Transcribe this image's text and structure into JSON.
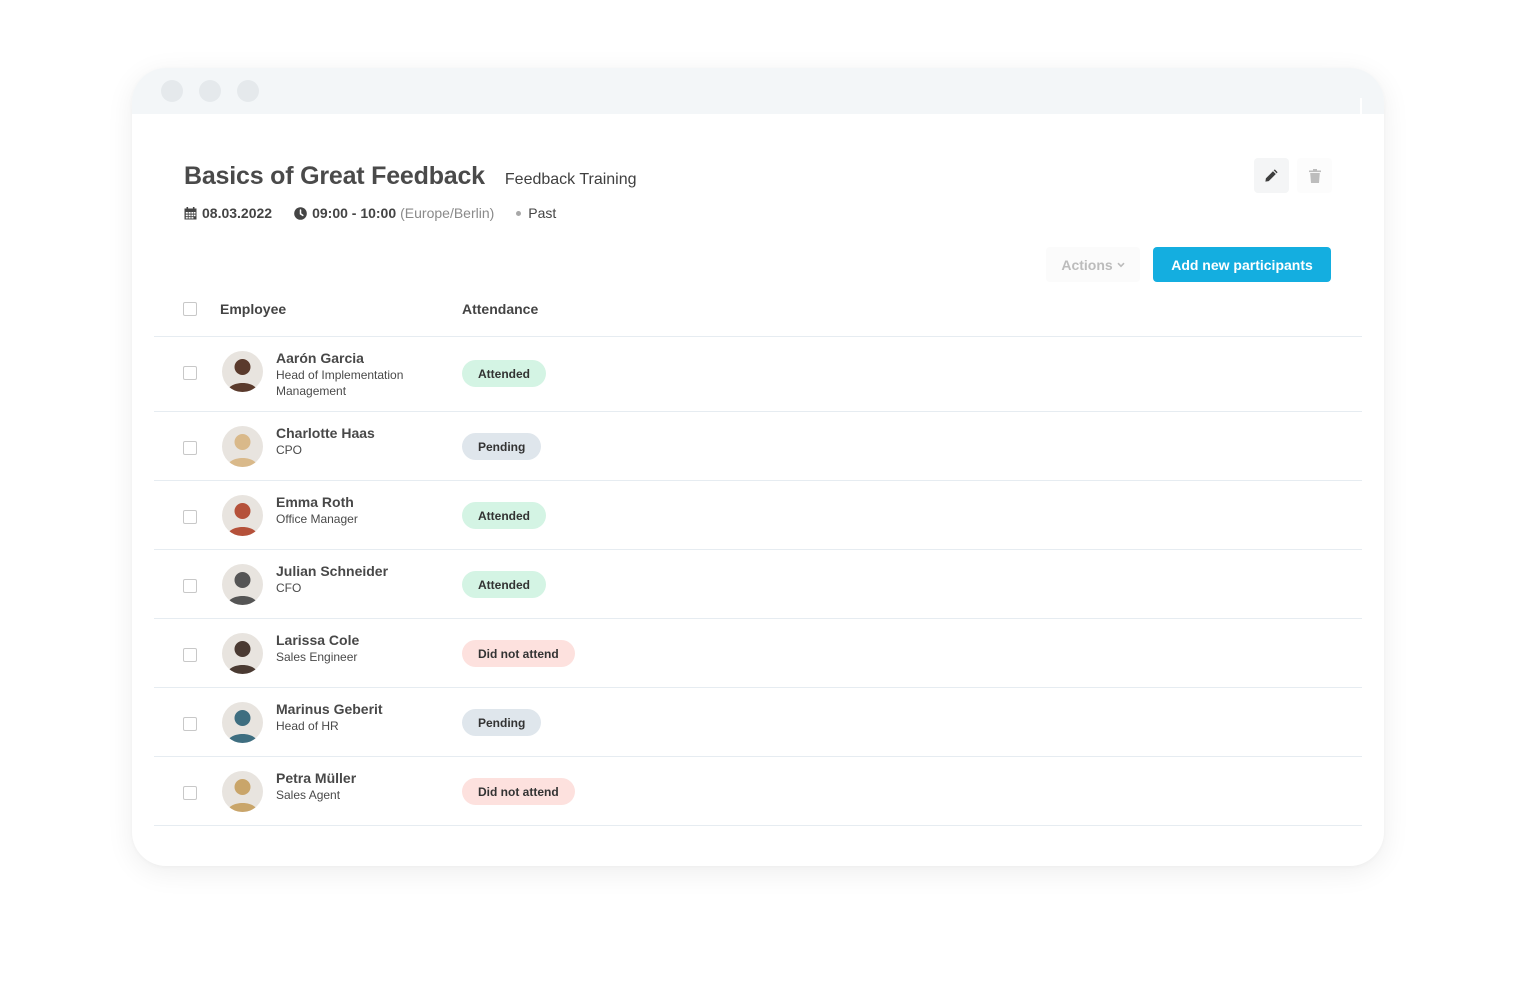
{
  "window": {
    "controls": [
      "close",
      "minimize",
      "maximize"
    ]
  },
  "header": {
    "title": "Basics of Great Feedback",
    "subtitle": "Feedback Training",
    "date": "08.03.2022",
    "time": "09:00 - 10:00",
    "timezone": "(Europe/Berlin)",
    "status": "Past"
  },
  "toolbar": {
    "actions_label": "Actions",
    "add_label": "Add new participants",
    "accent_color": "#14aee0"
  },
  "table": {
    "columns": [
      "Employee",
      "Attendance"
    ],
    "rows": [
      {
        "name": "Aarón Garcia",
        "role": "Head of Implementation Management",
        "attendance": "Attended",
        "status": "attended",
        "avatar_color": "#5a3a2c"
      },
      {
        "name": "Charlotte Haas",
        "role": "CPO",
        "attendance": "Pending",
        "status": "pending",
        "avatar_color": "#d9b98a"
      },
      {
        "name": "Emma Roth",
        "role": "Office Manager",
        "attendance": "Attended",
        "status": "attended",
        "avatar_color": "#b5513a"
      },
      {
        "name": "Julian Schneider",
        "role": "CFO",
        "attendance": "Attended",
        "status": "attended",
        "avatar_color": "#555555"
      },
      {
        "name": "Larissa Cole",
        "role": "Sales Engineer",
        "attendance": "Did not attend",
        "status": "not-attended",
        "avatar_color": "#4a3a32"
      },
      {
        "name": "Marinus Geberit",
        "role": "Head of HR",
        "attendance": "Pending",
        "status": "pending",
        "avatar_color": "#3e6e80"
      },
      {
        "name": "Petra Müller",
        "role": "Sales Agent",
        "attendance": "Did not attend",
        "status": "not-attended",
        "avatar_color": "#c9a56a"
      }
    ]
  },
  "colors": {
    "attended": "#d4f4e4",
    "pending": "#dfe6ec",
    "not_attended": "#fde1de"
  }
}
